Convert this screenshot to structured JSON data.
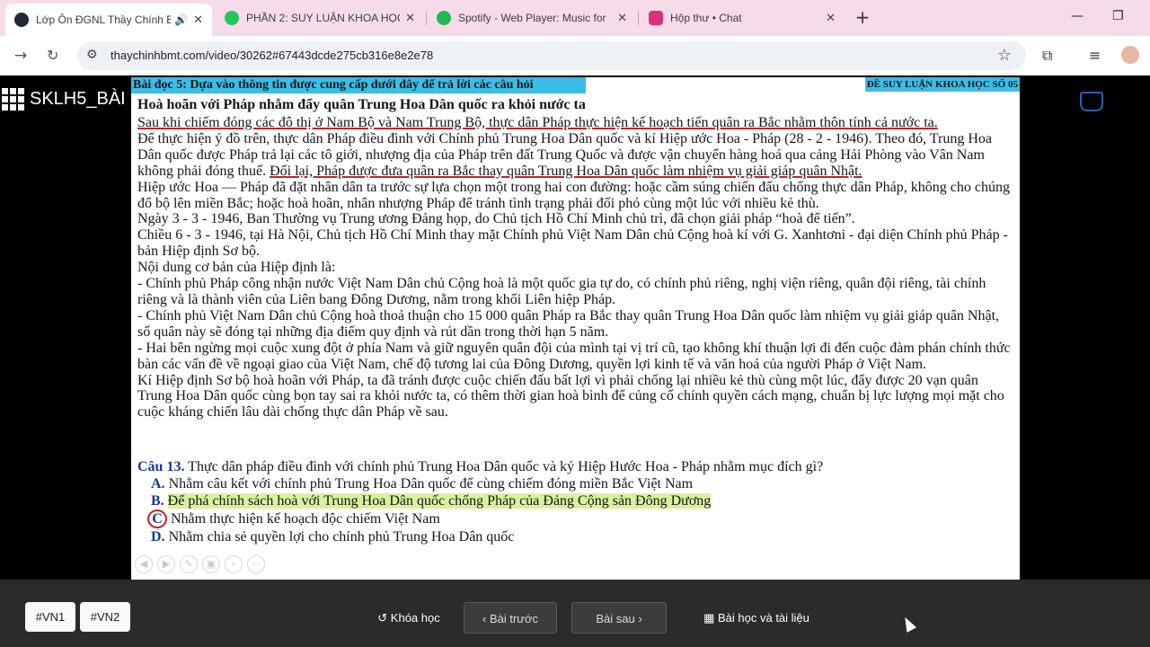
{
  "browser": {
    "tabs": [
      {
        "title": "Lớp Ôn ĐGNL Thầy Chính B",
        "favicon_color": "#1f2937",
        "active": true,
        "audio": true
      },
      {
        "title": "PHẦN 2: SUY LUẬN KHOA HỌC",
        "favicon_color": "#22c55e",
        "active": false
      },
      {
        "title": "Spotify - Web Player: Music for",
        "favicon_color": "#1db954",
        "active": false
      },
      {
        "title": "Hộp thư • Chat",
        "favicon_color": "#d9317a",
        "active": false
      }
    ],
    "close_glyph": "✕",
    "new_tab_glyph": "+",
    "url": "thaychinhbmt.com/video/30262#67443dcde275cb316e8e2e78"
  },
  "player": {
    "course_title": "SKLH5_BÀI",
    "slide": {
      "header": "Bài đọc 5: Dựa vào thông tin được cung cấp dưới đây để trả lời các câu hỏi",
      "exam_code": "ĐỀ SUY LUẬN KHOA HỌC SỐ 05",
      "subtitle": "Hoà hoãn với Pháp nhằm đẩy quân Trung Hoa Dân quốc ra khỏi nước ta",
      "p1": "Sau khi chiếm đóng các đô thị ở Nam Bộ và Nam Trung Bộ, thực dân Pháp thực hiện kế hoạch tiến quân ra Bắc nhằm thôn tính cả nước ta.",
      "p2a": "Để thực hiện ý đồ trên, thực dân Pháp điều đình với Chính phủ Trung Hoa Dân quốc và kí Hiệp ước Hoa - Pháp (28 - 2 - 1946). Theo đó, Trung Hoa Dân quốc được Pháp trả lại các tô giới, nhượng địa của Pháp trên đất Trung Quốc và được vận chuyển hàng hoá qua cảng Hải Phòng vào Vân Nam không phải đóng thuế.",
      "p2b": "Đổi lại, Pháp được đưa quân ra Bắc thay quân Trung Hoa Dân quốc làm nhiệm vụ giải giáp quân Nhật.",
      "p3": "Hiệp ước Hoa — Pháp đã đặt nhân dân ta trước sự lựa chọn một trong hai con đường: hoặc cầm súng chiến đấu chống thực dân Pháp, không cho chúng đổ bộ lên miền Bắc; hoặc hoà hoãn, nhân nhượng Pháp để tránh tình trạng phải đối phó cùng một lúc với nhiều kẻ thù.",
      "p4": "Ngày 3 - 3 - 1946, Ban Thường vụ Trung ương Đảng họp, do Chủ tịch Hồ Chí Minh chủ trì, đã chọn giải pháp “hoà để tiến”.",
      "p5": "Chiều 6 - 3 - 1946, tại Hà Nội, Chủ tịch Hồ Chí Minh thay mặt Chính phủ Việt Nam Dân chủ Cộng hoà kí với G. Xanhtơni - đại diện Chính phủ Pháp - bản Hiệp định Sơ bộ.",
      "p6": "Nội dung cơ bản của Hiệp định là:",
      "p7": "- Chính phủ Pháp công nhận nước Việt Nam Dân chủ Cộng hoà là một quốc gia tự do, có chính phủ riêng, nghị viện riêng, quân đội riêng, tài chính riêng và là thành viên của Liên bang Đông Dương, nằm trong khối Liên hiệp Pháp.",
      "p8": "- Chính phủ Việt Nam Dân chủ Cộng hoà thoả thuận cho 15 000 quân Pháp ra Bắc thay quân Trung Hoa Dân quốc làm nhiệm vụ giải giáp quân Nhật, số quân này sẽ đóng tại những địa điểm quy định và rút dần trong thời hạn 5 năm.",
      "p9": "- Hai bên ngừng mọi cuộc xung đột ở phía Nam và giữ nguyên quân đội của mình tại vị trí cũ, tạo không khí thuận lợi đi đến cuộc đàm phán chính thức bàn các vấn đề về ngoại giao của Việt Nam, chế độ tương lai của Đông Dương, quyền lợi kinh tế và văn hoá của người Pháp ở Việt Nam.",
      "p10": "Kí Hiệp định Sơ bộ hoà hoãn với Pháp, ta đã tránh được cuộc chiến đấu bất lợi vì phải chống lại nhiều kẻ thù cùng một lúc, đẩy được 20 vạn quân Trung Hoa Dân quốc cùng bọn tay sai ra khỏi nước ta, có thêm thời gian hoà bình để củng cố chính quyền cách mạng, chuẩn bị lực lượng mọi mặt cho cuộc kháng chiến lâu dài chống thực dân Pháp về sau.",
      "question_label": "Câu 13.",
      "question_text": "Thực dân pháp điều đình với chính phủ Trung Hoa Dân quốc và ký Hiệp Hước Hoa - Pháp nhằm mục đích gì?",
      "options": [
        {
          "letter": "A.",
          "text": "Nhằm câu kết với chính phủ Trung Hoa Dân quốc để cùng chiếm đóng miền Bắc Việt Nam"
        },
        {
          "letter": "B.",
          "text": "Để phá chính sách hoà với Trung Hoa Dân quốc chống Pháp của Đảng Cộng sản Đông Dương"
        },
        {
          "letter": "C",
          "text": "Nhằm thực hiện kế hoạch độc chiếm Việt Nam",
          "selected": true
        },
        {
          "letter": "D.",
          "text": "Nhằm chia sẻ quyền lợi cho chính phủ Trung Hoa Dân quốc"
        }
      ],
      "annotation_color": "#c0232c"
    }
  },
  "bottom": {
    "tags": [
      "#VN1",
      "#VN2"
    ],
    "course_btn": "Khóa học",
    "prev_btn": "Bài trước",
    "next_btn": "Bài sau",
    "materials_btn": "Bài học và tài liệu"
  }
}
